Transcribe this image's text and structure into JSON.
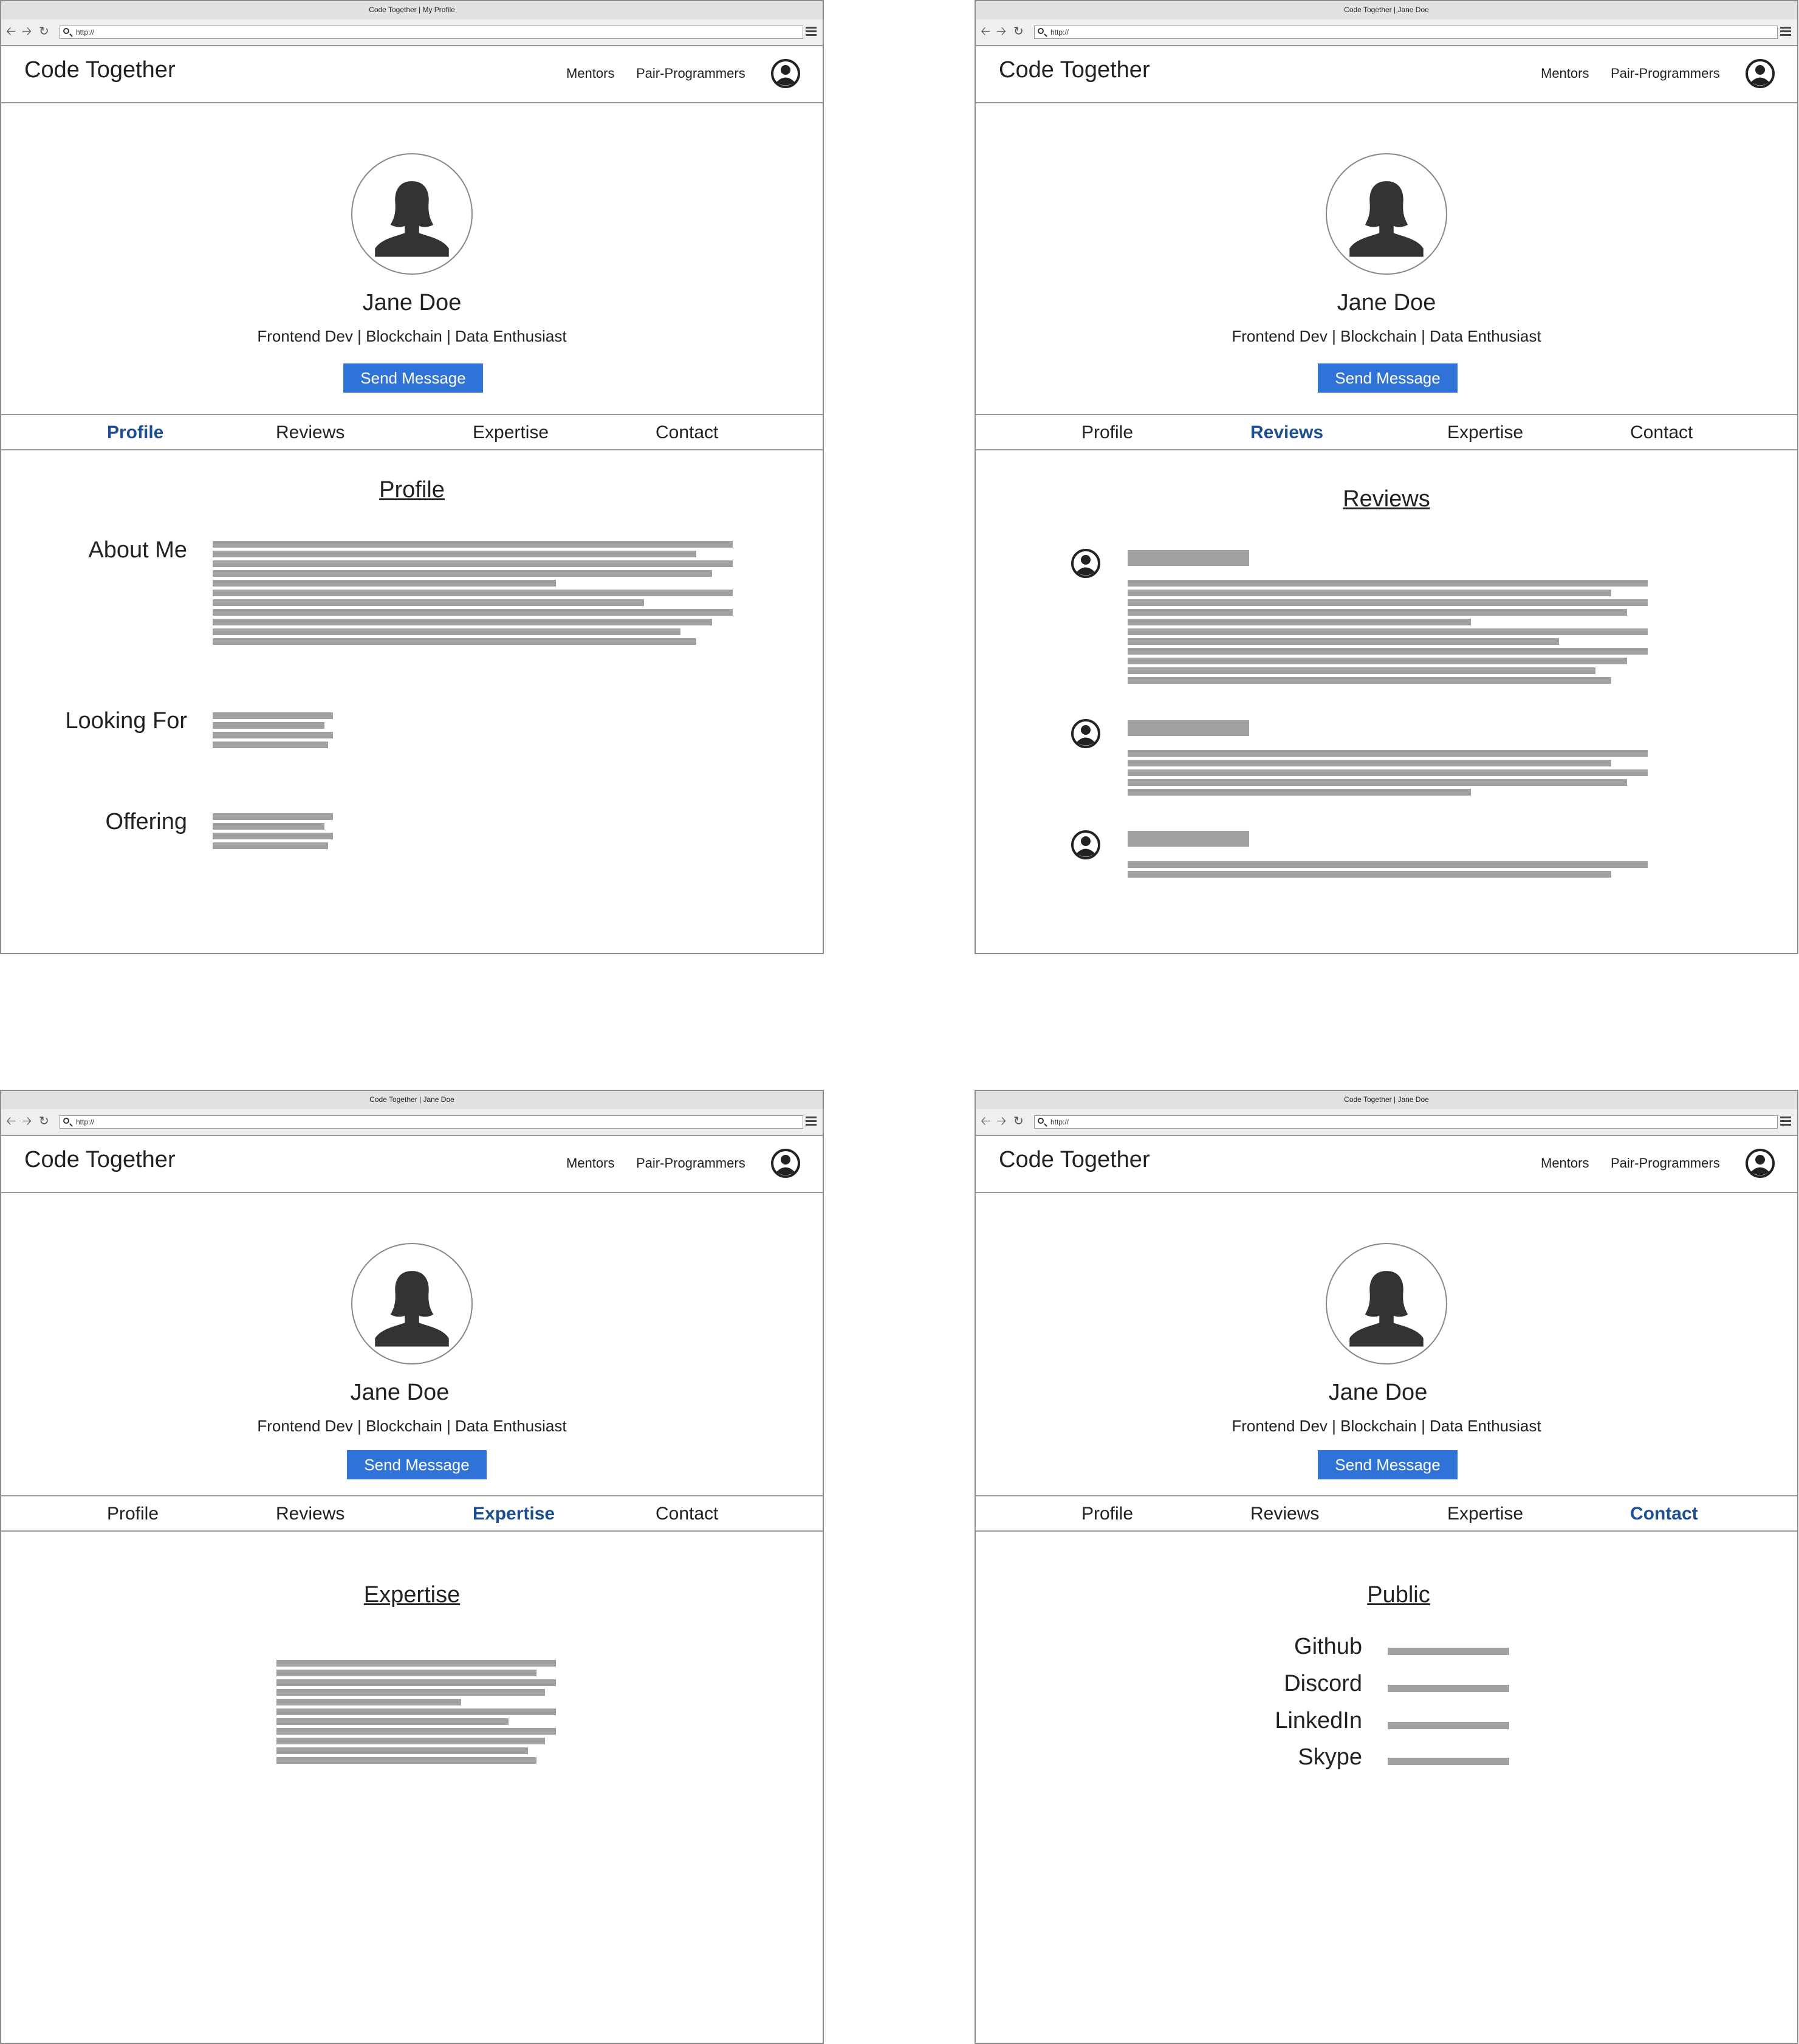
{
  "common": {
    "url": "http://",
    "brand": "Code Together",
    "nav_mentors": "Mentors",
    "nav_pair": "Pair-Programmers",
    "send_button": "Send Message",
    "tabs": [
      "Profile",
      "Reviews",
      "Expertise",
      "Contact"
    ]
  },
  "screens": [
    {
      "window_title": "Code Together | My Profile",
      "active_tab": "Profile",
      "name": "Jane Doe",
      "tagline": "Frontend Dev | Blockchain | Data Enthusiast",
      "section_title": "Profile",
      "labels": {
        "about": "About Me",
        "looking_for": "Looking For",
        "offering": "Offering"
      }
    },
    {
      "window_title": "Code Together | Jane Doe",
      "active_tab": "Reviews",
      "name": "Jane Doe",
      "tagline": "Frontend Dev | Blockchain | Data Enthusiast",
      "section_title": "Reviews"
    },
    {
      "window_title": "Code Together | Jane Doe",
      "active_tab": "Expertise",
      "name": "Jane Doe",
      "tagline": "Frontend Dev | Blockchain | Data Enthusiast",
      "section_title": "Expertise"
    },
    {
      "window_title": "Code Together | Jane Doe",
      "active_tab": "Contact",
      "name": "Jane Doe",
      "tagline": "Frontend Dev | Blockchain | Data Enthusiast",
      "section_title": "Public",
      "contacts": [
        "Github",
        "Discord",
        "LinkedIn",
        "Skype"
      ]
    }
  ],
  "colors": {
    "accent_button": "#2f73d8",
    "active_tab": "#1e4f91",
    "placeholder_lines": "#a0a0a0"
  },
  "icons": [
    "back-arrow-icon",
    "forward-arrow-icon",
    "reload-icon",
    "search-icon",
    "hamburger-menu-icon",
    "user-account-icon",
    "female-avatar-icon",
    "reviewer-avatar-icon"
  ]
}
